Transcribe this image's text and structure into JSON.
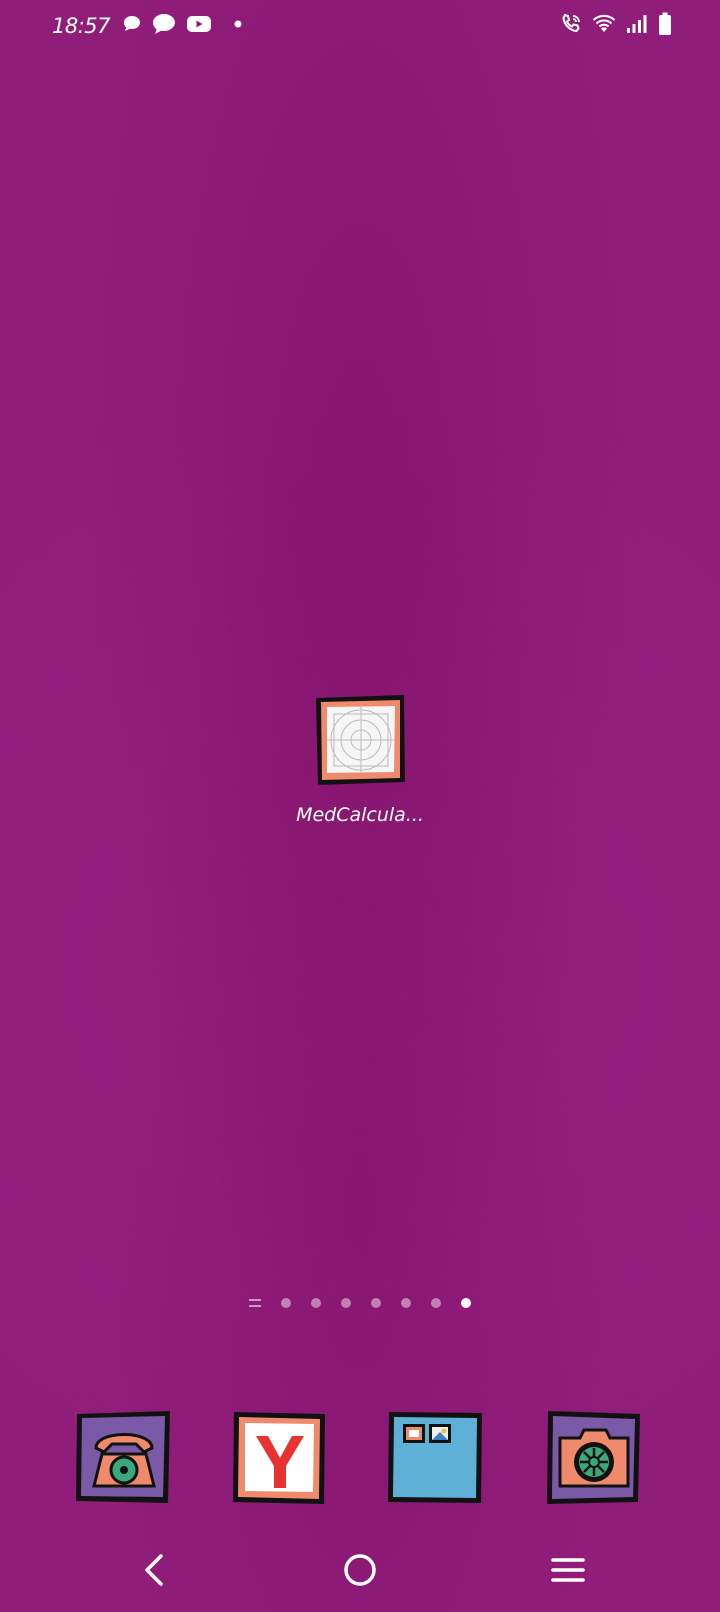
{
  "status_bar": {
    "time": "18:57",
    "left_icons": [
      "chat-bubble-icon",
      "message-icon",
      "youtube-icon",
      "notification-dot-icon"
    ],
    "right_icons": [
      "wifi-calling-icon",
      "wifi-icon",
      "signal-icon",
      "battery-icon"
    ]
  },
  "home": {
    "app": {
      "label": "MedCalcula...",
      "icon": "medcalculator-icon"
    },
    "page_indicator": {
      "total_pages": 7,
      "active_index": 6,
      "has_feed_page": true
    }
  },
  "dock": {
    "items": [
      {
        "name": "phone",
        "icon": "phone-icon"
      },
      {
        "name": "yandex",
        "icon": "yandex-browser-icon"
      },
      {
        "name": "gallery",
        "icon": "gallery-icon"
      },
      {
        "name": "camera",
        "icon": "camera-icon"
      }
    ]
  },
  "navigation": {
    "buttons": [
      "back-icon",
      "home-icon",
      "menu-icon"
    ]
  },
  "colors": {
    "wallpaper": "#901d7a",
    "icon_border": "#111111",
    "accent_salmon": "#f08a6c",
    "dock_purple": "#6a4f9a",
    "gallery_blue": "#5fb0d6",
    "yandex_red": "#e8322f"
  }
}
